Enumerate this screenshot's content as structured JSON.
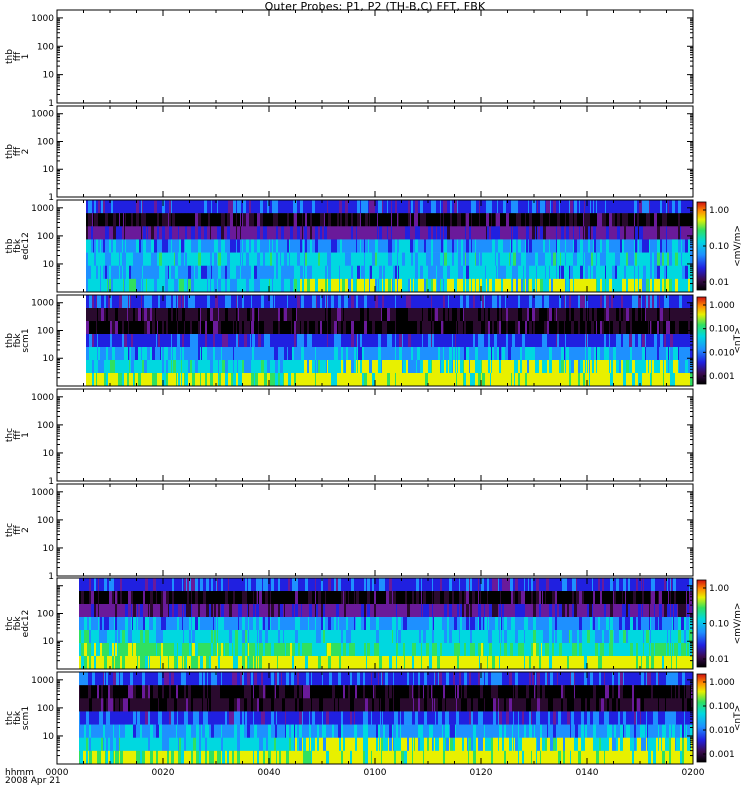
{
  "title": "Outer Probes: P1, P2 (TH-B,C) FFT, FBK",
  "time_axis": {
    "row1_label": "hhmm",
    "row2_label": "2008 Apr 21",
    "ticks": [
      "0000",
      "0020",
      "0040",
      "0100",
      "0120",
      "0140",
      "0200"
    ]
  },
  "colors": {
    "black": "#000000",
    "dark_purple": "#2a0a2e",
    "purple": "#6a1a9a",
    "blue": "#2020e0",
    "light_blue": "#1e90ff",
    "cyan": "#00d8e0",
    "green": "#30e060",
    "yellow": "#e8f000",
    "red": "#d01010"
  },
  "colorbars": [
    {
      "panel": 2,
      "unit": "<mV/m>",
      "ticks": [
        "1.00",
        "0.10",
        "0.01"
      ]
    },
    {
      "panel": 3,
      "unit": "<nT>",
      "ticks": [
        "1.000",
        "0.100",
        "0.010",
        "0.001"
      ]
    },
    {
      "panel": 6,
      "unit": "<mV/m>",
      "ticks": [
        "1.00",
        "0.10",
        "0.01"
      ]
    },
    {
      "panel": 7,
      "unit": "<nT>",
      "ticks": [
        "1.000",
        "0.100",
        "0.010",
        "0.001"
      ]
    }
  ],
  "chart_data": {
    "type": "heatmap",
    "panels": [
      {
        "name": "thb_fff_1",
        "ylabel_lines": [
          "thb",
          "fff",
          "1"
        ],
        "yticks": [
          "1000",
          "100",
          "10",
          "1"
        ],
        "has_data": false
      },
      {
        "name": "thb_fff_2",
        "ylabel_lines": [
          "thb",
          "fff",
          "2"
        ],
        "yticks": [
          "1000",
          "100",
          "10",
          "1"
        ],
        "has_data": false
      },
      {
        "name": "thb_fbk_edc12",
        "ylabel_lines": [
          "thb",
          "fbk",
          "edc12"
        ],
        "yticks": [
          "1000",
          "100",
          "10"
        ],
        "has_data": true,
        "bands": [
          "blue",
          "black",
          "purple",
          "light_blue",
          "cyan",
          "light_blue",
          "cyan"
        ]
      },
      {
        "name": "thb_fbk_scm1",
        "ylabel_lines": [
          "thb",
          "fbk",
          "scm1"
        ],
        "yticks": [
          "1000",
          "100",
          "10"
        ],
        "has_data": true,
        "bands": [
          "blue",
          "dark_purple",
          "black",
          "blue",
          "light_blue",
          "cyan",
          "yellow"
        ]
      },
      {
        "name": "thc_fff_1",
        "ylabel_lines": [
          "thc",
          "fff",
          "1"
        ],
        "yticks": [
          "1000",
          "100",
          "10",
          "1"
        ],
        "has_data": false
      },
      {
        "name": "thc_fff_2",
        "ylabel_lines": [
          "thc",
          "fff",
          "2"
        ],
        "yticks": [
          "1000",
          "100",
          "10",
          "1"
        ],
        "has_data": false
      },
      {
        "name": "thc_fbk_edc12",
        "ylabel_lines": [
          "thc",
          "fbk",
          "edc12"
        ],
        "yticks": [
          "100",
          "10"
        ],
        "has_data": true,
        "bands": [
          "blue",
          "black",
          "purple",
          "light_blue",
          "cyan",
          "green",
          "yellow"
        ]
      },
      {
        "name": "thc_fbk_scm1",
        "ylabel_lines": [
          "thc",
          "fbk",
          "scm1"
        ],
        "yticks": [
          "1000",
          "100",
          "10"
        ],
        "has_data": true,
        "bands": [
          "blue",
          "black",
          "dark_purple",
          "blue",
          "light_blue",
          "cyan",
          "yellow"
        ]
      }
    ]
  }
}
